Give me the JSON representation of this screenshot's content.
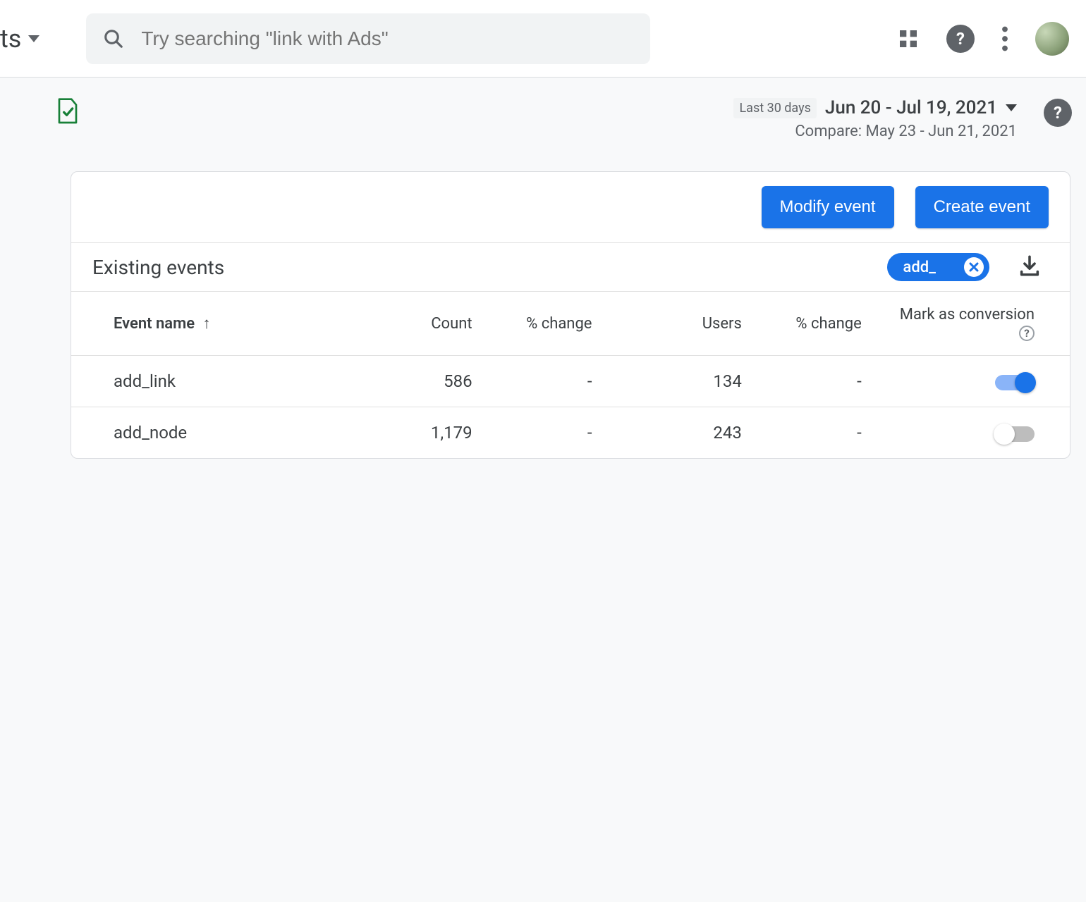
{
  "topbar": {
    "left_truncated_text": "ts",
    "search_placeholder": "Try searching \"link with Ads\""
  },
  "date_picker": {
    "badge": "Last 30 days",
    "range": "Jun 20 - Jul 19, 2021",
    "compare_label": "Compare: May 23 - Jun 21, 2021"
  },
  "actions": {
    "modify_label": "Modify event",
    "create_label": "Create event"
  },
  "table": {
    "title": "Existing events",
    "filter_value": "add_",
    "columns": {
      "name": "Event name",
      "count": "Count",
      "change1": "% change",
      "users": "Users",
      "change2": "% change",
      "conversion": "Mark as conversion"
    },
    "rows": [
      {
        "name": "add_link",
        "count": "586",
        "change1": "-",
        "users": "134",
        "change2": "-",
        "conversion_on": true
      },
      {
        "name": "add_node",
        "count": "1,179",
        "change1": "-",
        "users": "243",
        "change2": "-",
        "conversion_on": false
      }
    ]
  }
}
